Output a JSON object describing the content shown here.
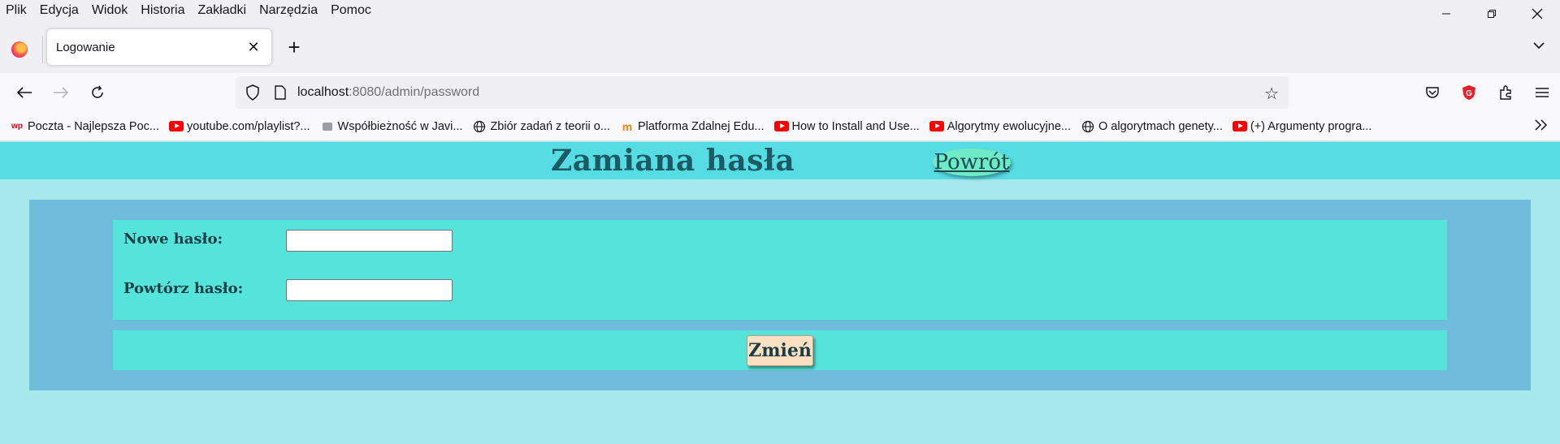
{
  "menubar": {
    "items": [
      "Plik",
      "Edycja",
      "Widok",
      "Historia",
      "Zakładki",
      "Narzędzia",
      "Pomoc"
    ]
  },
  "window_controls": {
    "minimize_icon": "minimize-icon",
    "restore_icon": "restore-icon",
    "close_icon": "close-icon"
  },
  "tabs": [
    {
      "title": "Logowanie",
      "active": true
    }
  ],
  "navbar": {
    "url_host": "localhost",
    "url_path": ":8080/admin/password"
  },
  "bookmarks": [
    {
      "label": "Poczta - Najlepsza Poc...",
      "icon": "wp-icon"
    },
    {
      "label": "youtube.com/playlist?...",
      "icon": "youtube-icon"
    },
    {
      "label": "Współbieżność w Javi...",
      "icon": "site-icon"
    },
    {
      "label": "Zbiór zadań z teorii o...",
      "icon": "globe-icon"
    },
    {
      "label": "Platforma Zdalnej Edu...",
      "icon": "moodle-icon"
    },
    {
      "label": "How to Install and Use...",
      "icon": "youtube-icon"
    },
    {
      "label": "Algorytmy ewolucyjne...",
      "icon": "youtube-icon"
    },
    {
      "label": "O algorytmach genety...",
      "icon": "globe-icon"
    },
    {
      "label": "(+) Argumenty progra...",
      "icon": "youtube-icon"
    }
  ],
  "page": {
    "title": "Zamiana hasła",
    "back_link": "Powrót",
    "form": {
      "new_password_label": "Nowe hasło:",
      "new_password_value": "",
      "repeat_password_label": "Powtórz hasło:",
      "repeat_password_value": "",
      "submit_label": "Zmień"
    }
  },
  "colors": {
    "header_bg": "#56dde4",
    "page_bg": "#a6e8ec",
    "form_bg": "#6fbcdc",
    "panel_bg": "#55e4da",
    "button_bg": "#fde0c1",
    "back_link_bg": "#6eeac6"
  }
}
